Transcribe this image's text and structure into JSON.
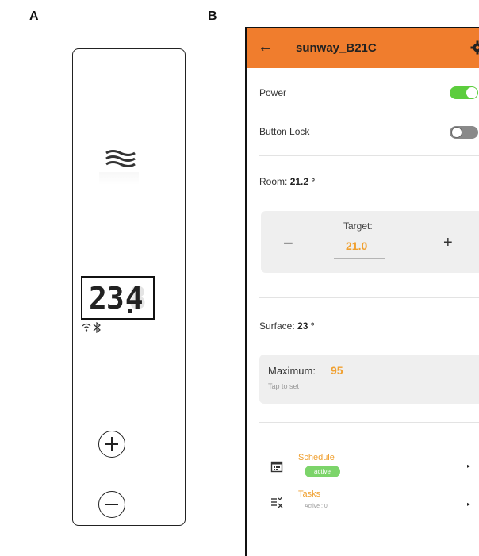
{
  "figure": {
    "panel_a_label": "A",
    "panel_b_label": "B"
  },
  "device": {
    "display_value": "23.4",
    "display_digits": "23",
    "display_decimal": "4",
    "heat_icon": "heat-waves-icon",
    "status_icons": [
      "wifi-icon",
      "bluetooth-icon"
    ],
    "plus_icon": "plus-circle-icon",
    "minus_icon": "minus-circle-icon"
  },
  "app": {
    "back_icon": "back-arrow-icon",
    "title": "sunway_B21C",
    "settings_icon": "gear-icon",
    "accent_color": "#f07d2d",
    "value_color": "#f0a030",
    "toggle_on_color": "#5ccd3d",
    "power": {
      "label": "Power",
      "state": "on"
    },
    "button_lock": {
      "label": "Button Lock",
      "state": "off"
    },
    "room": {
      "label": "Room:",
      "value": "21.2 °"
    },
    "target": {
      "label": "Target:",
      "value": "21.0",
      "decrement": "−",
      "increment": "+"
    },
    "surface": {
      "label": "Surface:",
      "value": "23 °"
    },
    "maximum": {
      "label": "Maximum:",
      "value": "95",
      "hint": "Tap to set"
    },
    "schedule": {
      "title": "Schedule",
      "badge": "active",
      "icon": "calendar-icon",
      "chevron": "▸"
    },
    "tasks": {
      "title": "Tasks",
      "subtitle": "Active : 0",
      "icon": "tasks-icon",
      "chevron": "▸"
    }
  }
}
